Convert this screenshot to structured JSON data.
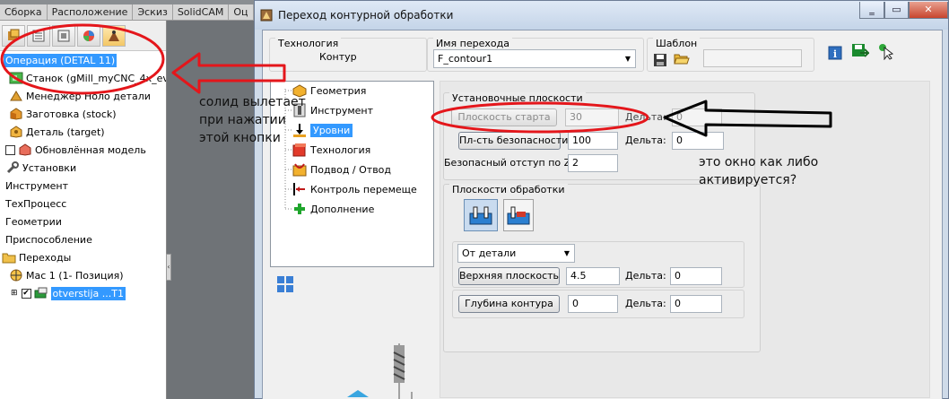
{
  "solidworks": {
    "tabs": [
      "Сборка",
      "Расположение",
      "Эскиз",
      "SolidCAM",
      "Оц"
    ],
    "tree": [
      "Операция (DETAL 11)",
      "Станок (gMill_myCNC_4x_eval )",
      "Менеджер Ноло детали",
      "Заготовка (stock)",
      "Деталь (target)",
      "Обновлённая модель",
      "Установки",
      "Инструмент",
      "ТехПроцесс",
      "Геометрии",
      "Приспособление",
      "Переходы",
      "Мас 1 (1- Позиция)",
      "otverstija ...T1"
    ]
  },
  "dialog": {
    "title": "Переход контурной обработки",
    "technology_group_title": "Технология",
    "technology_value": "Контур",
    "operation_name_group_title": "Имя перехода",
    "operation_name_value": "F_contour1",
    "template_group_title": "Шаблон",
    "tree_items": [
      "Геометрия",
      "Инструмент",
      "Уровни",
      "Технология",
      "Подвод / Отвод",
      "Контроль перемеще",
      "Дополнение"
    ],
    "selected_tree_item": "Уровни",
    "setup_planes_title": "Установочные плоскости",
    "start_plane_button": "Плоскость старта",
    "start_plane_value": "30",
    "delta_label": "Дельта:",
    "start_delta_value": "0",
    "safety_plane_button": "Пл-сть безопасности",
    "safety_plane_value": "100",
    "safety_delta_value": "0",
    "safe_offset_label": "Безопасный отступ по Z:",
    "safe_offset_value": "2",
    "machining_planes_title": "Плоскости обработки",
    "from_dropdown": "От детали",
    "upper_plane_button": "Верхняя плоскость",
    "upper_plane_value": "4.5",
    "upper_delta_value": "0",
    "depth_button": "Глубина контура",
    "depth_value": "0",
    "depth_delta_value": "0"
  },
  "annotations": {
    "left_note": [
      "солид вылетает",
      "при нажатии",
      "этой кнопки"
    ],
    "right_note": [
      "это окно как либо",
      "активируется?"
    ]
  },
  "colors": {
    "selection": "#3399ff",
    "annotation_red": "#e4161b",
    "dialog_bg": "#f0f0f0"
  }
}
